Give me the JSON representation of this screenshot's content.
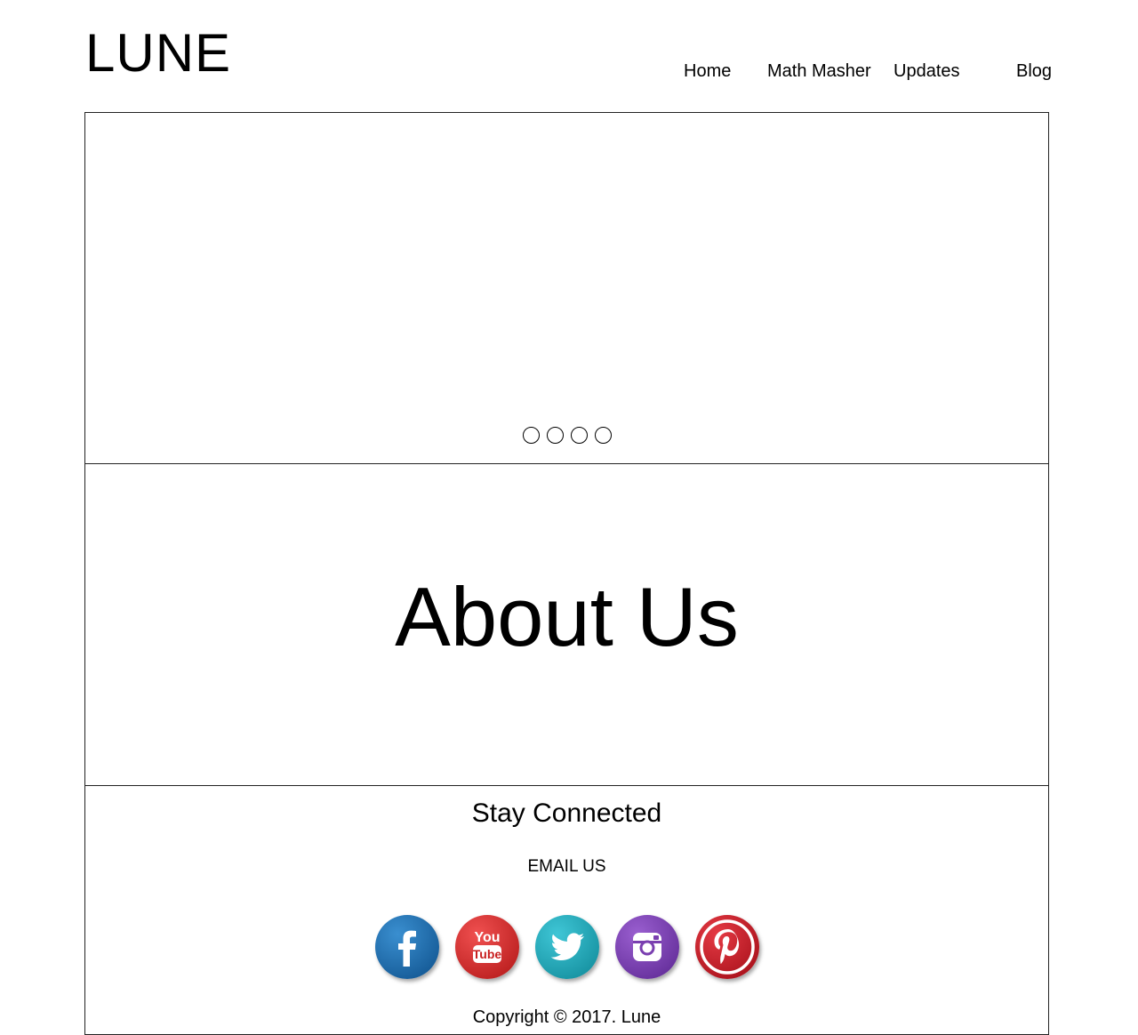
{
  "header": {
    "logo": "LUNE",
    "nav": {
      "home": "Home",
      "math_masher": "Math Masher",
      "updates": "Updates",
      "blog": "Blog"
    }
  },
  "hero": {
    "slide_indicator_count": 4
  },
  "about": {
    "title": "About Us"
  },
  "footer": {
    "heading": "Stay Connected",
    "email_link": "EMAIL US",
    "social": [
      {
        "name": "facebook-icon",
        "color": "#1565a8"
      },
      {
        "name": "youtube-icon",
        "color": "#d42a2a"
      },
      {
        "name": "twitter-icon",
        "color": "#1aa6b8"
      },
      {
        "name": "instagram-icon",
        "color": "#7a3fb0"
      },
      {
        "name": "pinterest-icon",
        "color": "#c8121e"
      }
    ],
    "copyright": "Copyright © 2017. Lune"
  }
}
